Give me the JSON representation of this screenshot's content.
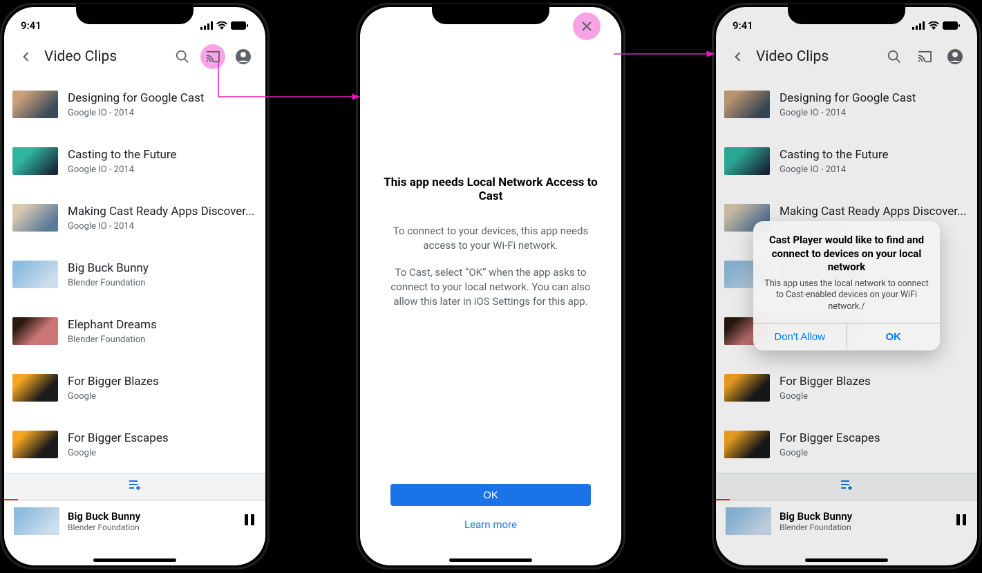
{
  "status": {
    "time": "9:41"
  },
  "appbar": {
    "title": "Video Clips"
  },
  "videos": [
    {
      "title": "Designing for Google Cast",
      "sub": "Google IO - 2014"
    },
    {
      "title": "Casting to the Future",
      "sub": "Google IO - 2014"
    },
    {
      "title": "Making Cast Ready Apps Discover...",
      "sub": "Google IO - 2014"
    },
    {
      "title": "Big Buck Bunny",
      "sub": "Blender Foundation"
    },
    {
      "title": "Elephant Dreams",
      "sub": "Blender Foundation"
    },
    {
      "title": "For Bigger Blazes",
      "sub": "Google"
    },
    {
      "title": "For Bigger Escapes",
      "sub": "Google"
    }
  ],
  "mini": {
    "title": "Big Buck Bunny",
    "sub": "Blender Foundation"
  },
  "interstitial": {
    "title": "This app needs Local Network Access to Cast",
    "p1": "To connect to your devices, this app needs access to your Wi-Fi network.",
    "p2": "To Cast, select “OK” when the app asks to connect to your local network. You can also allow this later in iOS Settings for this app.",
    "ok": "OK",
    "learn": "Learn more"
  },
  "alert": {
    "title": "Cast Player would like to find and connect to devices on your local network",
    "msg": "This app uses the local network to connect to Cast-enabled devices on your WiFi network./",
    "dont": "Don't Allow",
    "ok": "OK"
  }
}
